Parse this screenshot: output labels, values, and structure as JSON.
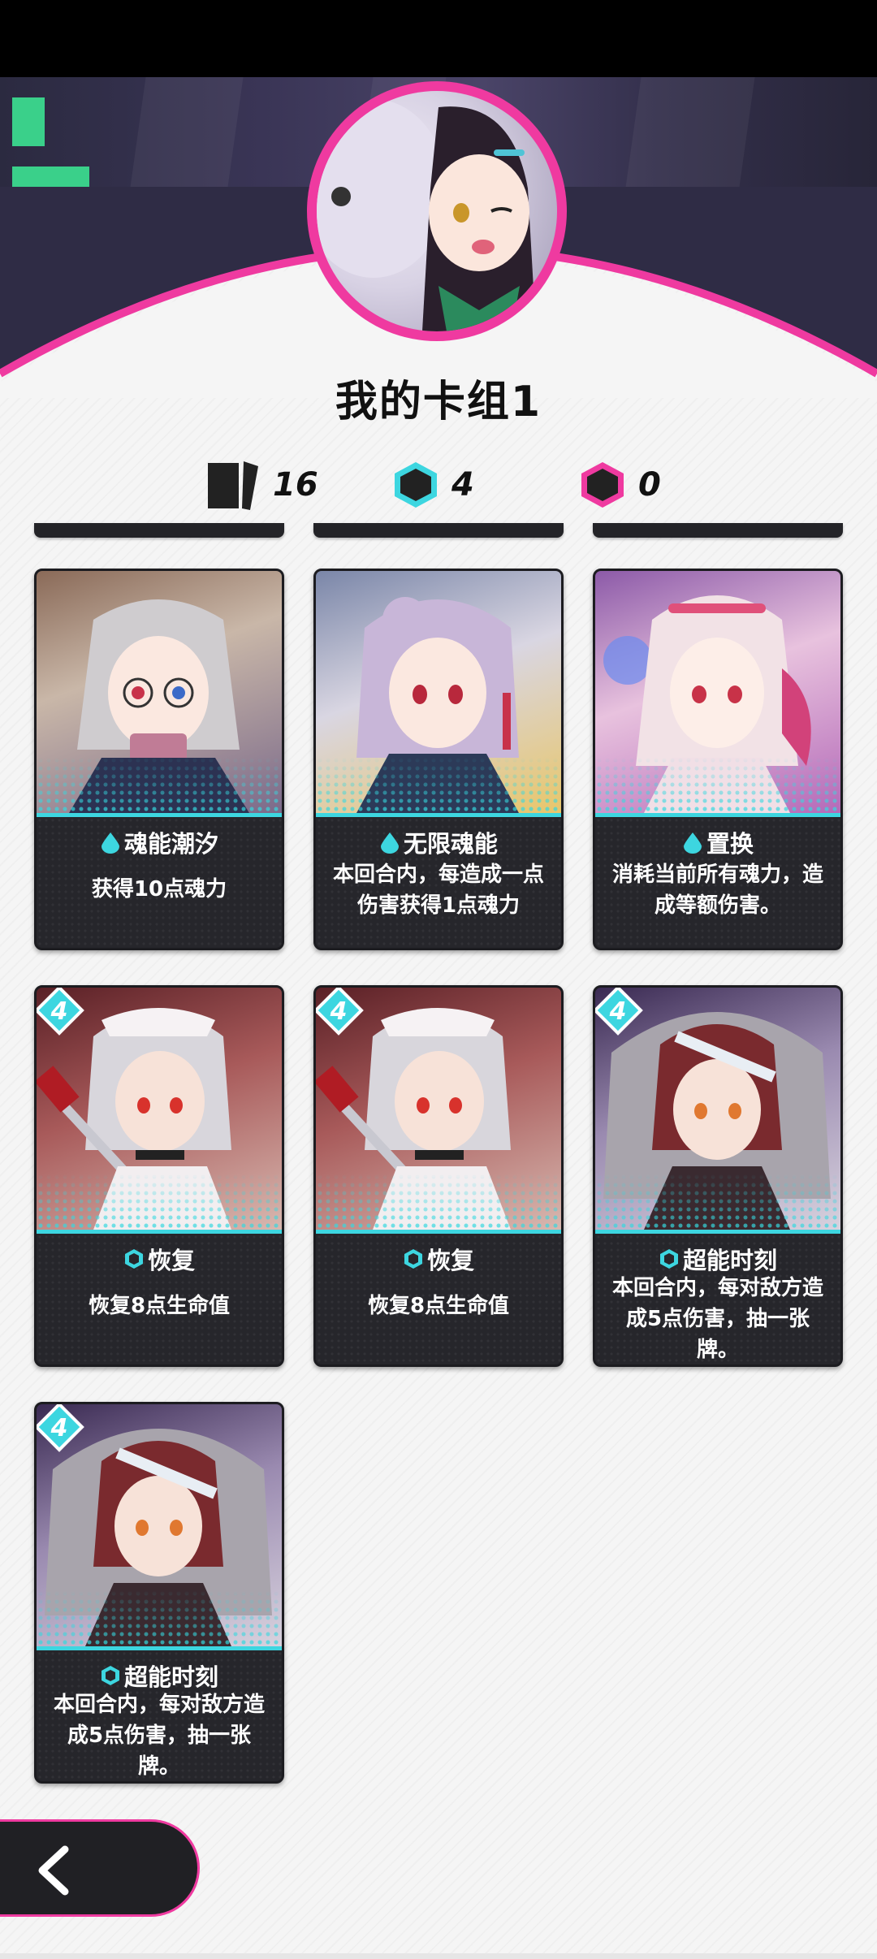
{
  "deck": {
    "title": "我的卡组1",
    "card_count": "16",
    "cyan_cost_count": "4",
    "magenta_cost_count": "0"
  },
  "colors": {
    "accent_pink": "#ef3aa0",
    "accent_cyan": "#3dd6e0",
    "card_dark": "#26262b"
  },
  "cards": [
    {
      "cost": "",
      "type_icon": "droplet-icon",
      "name": "魂能潮汐",
      "desc": "获得10点魂力"
    },
    {
      "cost": "",
      "type_icon": "droplet-icon",
      "name": "无限魂能",
      "desc": "本回合内，每造成一点伤害获得1点魂力"
    },
    {
      "cost": "",
      "type_icon": "droplet-icon",
      "name": "置换",
      "desc": "消耗当前所有魂力，造成等额伤害。"
    },
    {
      "cost": "4",
      "type_icon": "hexagon-icon",
      "name": "恢复",
      "desc": "恢复8点生命值"
    },
    {
      "cost": "4",
      "type_icon": "hexagon-icon",
      "name": "恢复",
      "desc": "恢复8点生命值"
    },
    {
      "cost": "4",
      "type_icon": "hexagon-icon",
      "name": "超能时刻",
      "desc": "本回合内，每对敌方造成5点伤害，抽一张牌。"
    },
    {
      "cost": "4",
      "type_icon": "hexagon-icon",
      "name": "超能时刻",
      "desc": "本回合内，每对敌方造成5点伤害，抽一张牌。"
    }
  ],
  "icons": {
    "back": "chevron-left-icon",
    "cards": "card-stack-icon",
    "cyan_hex": "cyan-hexagon-icon",
    "pink_hex": "magenta-hexagon-icon"
  }
}
